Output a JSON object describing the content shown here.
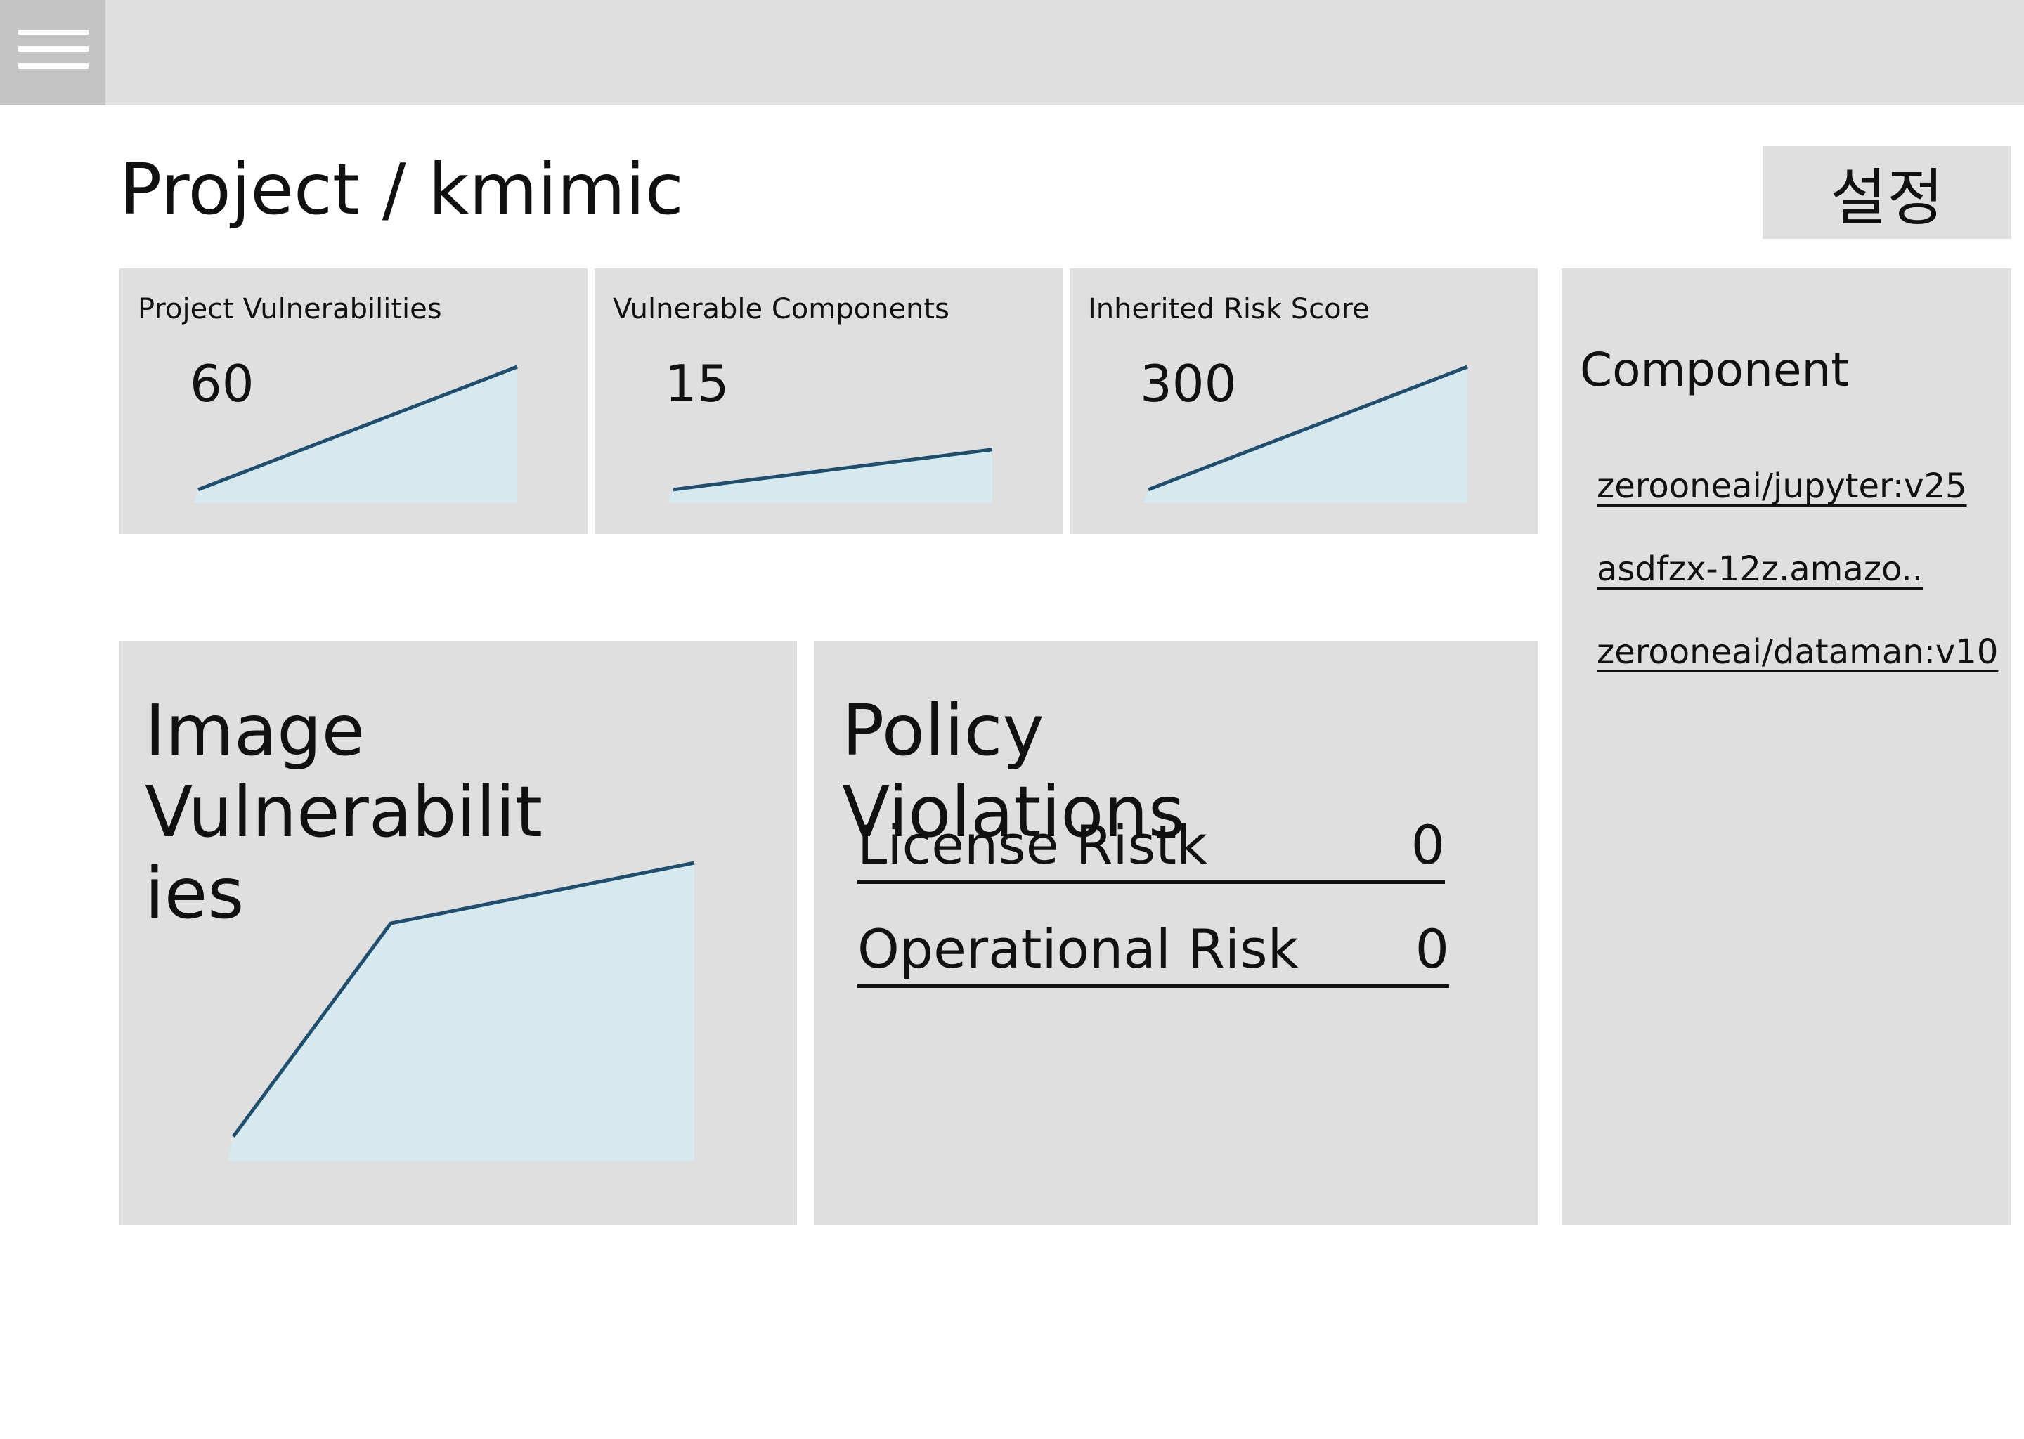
{
  "topbar": {
    "menu_icon": "hamburger-menu-icon"
  },
  "header": {
    "title": "Project / kmimic",
    "settings_label": "설정"
  },
  "stat_cards": [
    {
      "title": "Project Vulnerabilities",
      "value": "60",
      "trend": [
        0.05,
        1.0
      ]
    },
    {
      "title": "Vulnerable Components",
      "value": "15",
      "trend": [
        0.05,
        0.36
      ]
    },
    {
      "title": "Inherited Risk Score",
      "value": "300",
      "trend": [
        0.05,
        1.0
      ]
    }
  ],
  "image_vulnerabilities": {
    "heading_lines": [
      "Image",
      "Vulnerabilit",
      "ies"
    ],
    "trend": [
      0.05,
      0.79,
      1.0
    ]
  },
  "policy_violations": {
    "heading_lines": [
      "Policy",
      "Violations"
    ],
    "rows": [
      {
        "label": "License Ristk",
        "value": "0"
      },
      {
        "label": "Operational Risk",
        "value": "0"
      }
    ]
  },
  "components": {
    "heading": "Component",
    "items": [
      "zerooneai/jupyter:v25",
      "asdfzx-12z.amazo..",
      "zerooneai/dataman:v10"
    ]
  },
  "colors": {
    "panel_bg": "#dfdfdf",
    "chart_line": "#1f4e6e",
    "chart_fill": "#d6e9ef"
  }
}
